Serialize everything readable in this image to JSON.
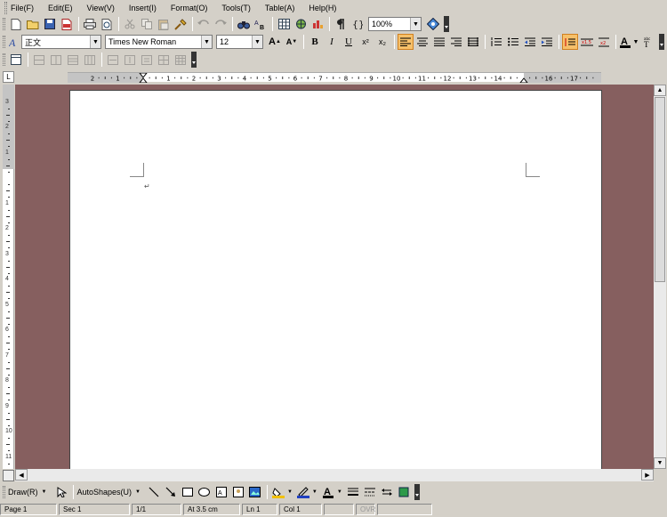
{
  "menu": [
    "File(F)",
    "Edit(E)",
    "View(V)",
    "Insert(I)",
    "Format(O)",
    "Tools(T)",
    "Table(A)",
    "Help(H)"
  ],
  "toolbar": {
    "zoom": "100%",
    "style": "正文",
    "font": "Times New Roman",
    "size": "12",
    "bold": "B",
    "italic": "I",
    "underline": "U",
    "superscript": "x²",
    "subscript": "x₂",
    "fontcolor_letter": "A",
    "highlight_letter": "ab",
    "grow_font": "A",
    "shrink_font": "A",
    "zh_glyph": "T"
  },
  "ruler": {
    "h_labels": [
      "2",
      "1",
      "",
      "1",
      "2",
      "3",
      "4",
      "5",
      "6",
      "7",
      "8",
      "9",
      "10",
      "11",
      "12",
      "13",
      "14",
      "",
      "16",
      "17"
    ],
    "v_labels": [
      "3",
      "2",
      "1",
      "",
      "1",
      "2",
      "3",
      "4",
      "5",
      "6",
      "7",
      "8",
      "9",
      "10",
      "11"
    ]
  },
  "document": {
    "paragraph_mark": "↵"
  },
  "drawbar": {
    "draw": "Draw(R)",
    "autoshapes": "AutoShapes(U)",
    "fill_color": "#f0c000",
    "line_color": "#2040c0",
    "font_color": "#000000"
  },
  "status": {
    "page": "Page 1",
    "sec": "Sec 1",
    "pages": "1/1",
    "at": "At 3.5 cm",
    "ln": "Ln 1",
    "col": "Col 1",
    "ovr": "OVR"
  },
  "colors": {
    "canvas": "#865f5f",
    "chrome": "#d4d0c8",
    "active_button": "#f6c06a"
  }
}
